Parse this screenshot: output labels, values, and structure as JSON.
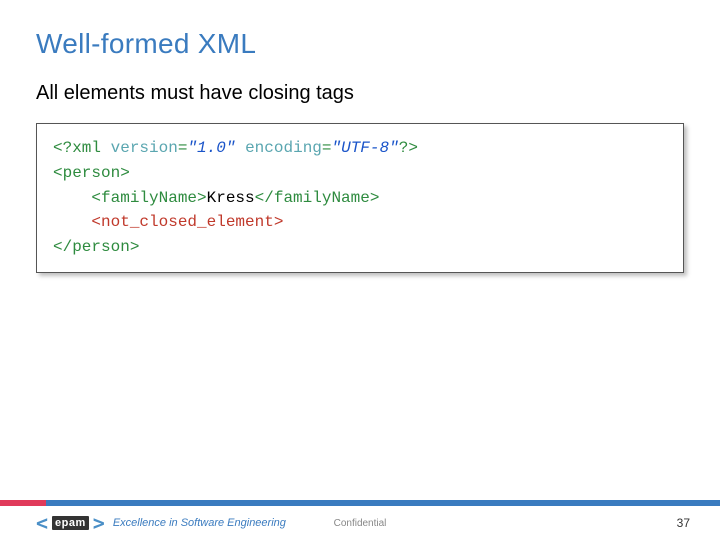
{
  "title": "Well-formed XML",
  "subtitle": "All elements must have closing tags",
  "code": {
    "pi_open": "<?",
    "pi_name": "xml",
    "attr1_name": "version",
    "eq": "=",
    "attr1_val": "\"1.0\"",
    "attr2_name": "encoding",
    "attr2_val": "\"UTF-8\"",
    "pi_close": "?>",
    "person_open": "<person>",
    "family_open": "<familyName>",
    "family_text": "Kress",
    "family_close": "</familyName>",
    "not_closed": "<not_closed_element>",
    "person_close": "</person>",
    "indent": "    "
  },
  "footer": {
    "logo_open": "<",
    "logo_word": "epam",
    "logo_close": ">",
    "tagline": "Excellence in Software Engineering",
    "confidential": "Confidential",
    "page": "37"
  }
}
